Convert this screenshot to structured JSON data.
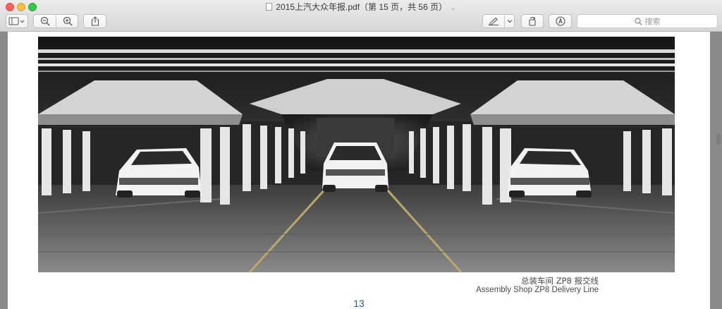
{
  "window": {
    "title": "2015上汽大众年报.pdf（第 15 页，共 56 页）"
  },
  "toolbar": {
    "search_placeholder": "搜索",
    "buttons": [
      "sidebar-toggle",
      "zoom-out",
      "zoom-in",
      "share",
      "markup",
      "markup-menu",
      "rotate",
      "annotate"
    ]
  },
  "document": {
    "caption_zh": "总装车间 ZP8 报交线",
    "caption_en": "Assembly Shop ZP8 Delivery Line",
    "page_number": "13"
  },
  "colors": {
    "page_number": "#2f5f74",
    "close": "#fc605c",
    "minimize": "#fdbc40",
    "maximize": "#34c84a"
  }
}
